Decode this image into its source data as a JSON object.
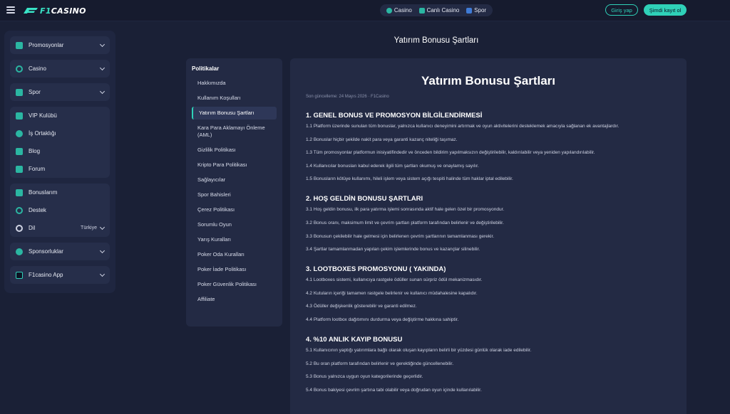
{
  "header": {
    "logo_text_a": "F1",
    "logo_text_b": "CASINO",
    "nav": [
      "Casino",
      "Canlı Casino",
      "Spor"
    ],
    "login_label": "Giriş yap",
    "signup_label": "Şimdi kayıt ol"
  },
  "sidebar": {
    "promotions": "Promosyonlar",
    "casino": "Casino",
    "sports": "Spor",
    "vip": "VIP Kulübü",
    "affiliates": "İş Ortaklığı",
    "blog": "Blog",
    "forum": "Forum",
    "bonuses": "Bonuslarım",
    "support": "Destek",
    "language": "Dil",
    "language_value": "Türkiye",
    "sponsorships": "Sponsorluklar",
    "app": "F1casino App"
  },
  "page_title": "Yatırım Bonusu Şartları",
  "policies": {
    "heading": "Politikalar",
    "items": [
      "Hakkımızda",
      "Kullanım Koşulları",
      "Yatırım Bonusu Şartları",
      "Kara Para Aklamayı Önleme (AML)",
      "Gizlilik Politikası",
      "Kripto Para Politikası",
      "Sağlayıcılar",
      "Spor Bahisleri",
      "Çerez Politikası",
      "Sorumlu Oyun",
      "Yarış Kuralları",
      "Poker Oda Kuralları",
      "Poker İade Politikası",
      "Poker Güvenlik Politikası",
      "Affiliate"
    ]
  },
  "doc": {
    "title": "Yatırım Bonusu Şartları",
    "meta": "Son güncelleme: 24 Mayıs 2026 · F1Casino",
    "sections": [
      {
        "heading": "1. GENEL BONUS VE PROMOSYON BİLGİLENDİRMESİ",
        "paras": [
          "1.1 Platform üzerinde sunulan tüm bonuslar, yalnızca kullanıcı deneyimini artırmak ve oyun aktivitelerini desteklemek amacıyla sağlanan ek avantajlardır.",
          "1.2 Bonuslar hiçbir şekilde nakit para veya garanti kazanç niteliği taşımaz.",
          "1.3 Tüm promosyonlar platformun inisiyatifindedir ve önceden bildirim yapılmaksızın değiştirilebilir, kaldırılabilir veya yeniden yapılandırılabilir.",
          "1.4 Kullanıcılar bonusları kabul ederek ilgili tüm şartları okumuş ve onaylamış sayılır.",
          "1.5 Bonusların kötüye kullanımı, hileli işlem veya sistem açığı tespiti halinde tüm haklar iptal edilebilir."
        ]
      },
      {
        "heading": "2. HOŞ GELDİN BONUSU ŞARTLARI",
        "paras": [
          "3.1 Hoş geldin bonusu, ilk para yatırma işlemi sonrasında aktif hale gelen özel bir promosyondur.",
          "3.2 Bonus oranı, maksimum limit ve çevrim şartları platform tarafından belirlenir ve değiştirilebilir.",
          "3.3 Bonusun çekilebilir hale gelmesi için belirlenen çevrim şartlarının tamamlanması gerekir.",
          "3.4 Şartlar tamamlanmadan yapılan çekim işlemlerinde bonus ve kazançlar silinebilir."
        ]
      },
      {
        "heading": "3. LOOTBOXES PROMOSYONU ( YAKINDA)",
        "paras": [
          "4.1 Lootboxes sistemi, kullanıcıya rastgele ödüller sunan sürpriz ödül mekanizmasıdır.",
          "4.2 Kutuların içeriği tamamen rastgele belirlenir ve kullanıcı müdahalesine kapalıdır.",
          "4.3 Ödüller değişkenlik gösterebilir ve garanti edilmez.",
          "4.4 Platform lootbox dağıtımını durdurma veya değiştirme hakkına sahiptir."
        ]
      },
      {
        "heading": "4. %10 ANLIK KAYIP BONUSU",
        "paras": [
          "5.1 Kullanıcının yaptığı yatırımlara bağlı olarak oluşan kayıpların belirli bir yüzdesi günlük olarak iade edilebilir.",
          "5.2 Bu oran platform tarafından belirlenir ve gerektiğinde güncellenebilir.",
          "5.3 Bonus yalnızca uygun oyun kategorilerinde geçerlidir.",
          "5.4 Bonus bakiyesi çevrim şartına tabi olabilir veya doğrudan oyun içinde kullanılabilir."
        ]
      }
    ]
  },
  "colors": {
    "accent": "#2fd1b8",
    "background": "#1a2036",
    "panel": "#232a44"
  }
}
